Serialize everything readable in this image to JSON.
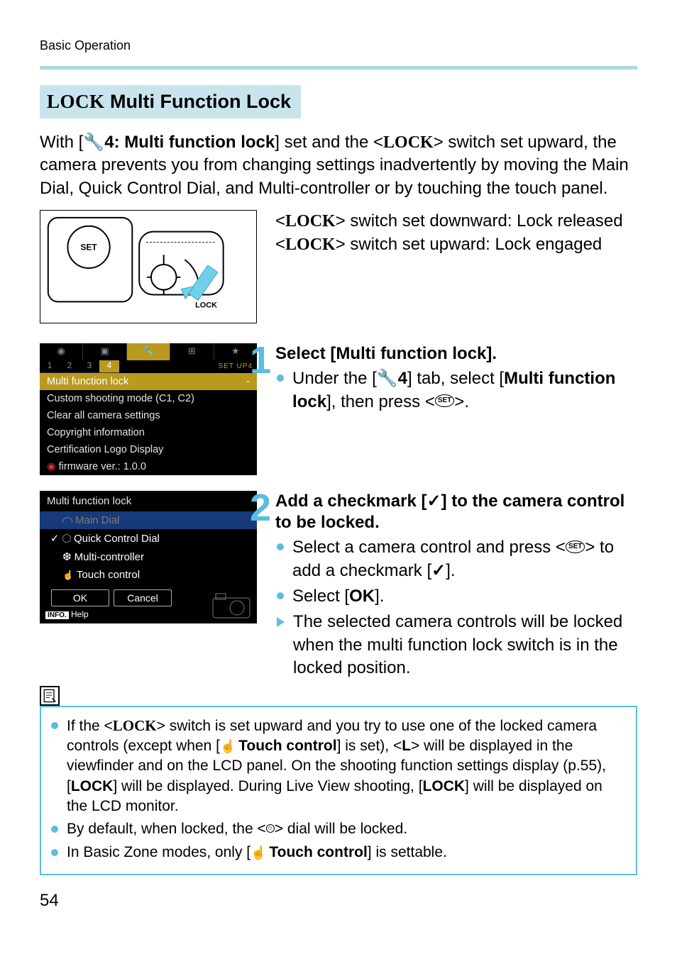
{
  "header": {
    "breadcrumb": "Basic Operation"
  },
  "section_title": {
    "lock": "LOCK",
    "rest": " Multi Function Lock"
  },
  "intro": {
    "pre": "With [",
    "setting": "4: Multi function lock",
    "mid": "] set and the <",
    "lockword": "LOCK",
    "post": "> switch set upward, the camera prevents you from changing settings inadvertently by moving the Main Dial, Quick Control Dial, and Multi-controller or by touching the touch panel."
  },
  "switch_desc": {
    "down_pre": "<",
    "down_lock": "LOCK",
    "down_post": "> switch set downward: Lock released",
    "up_pre": "<",
    "up_lock": "LOCK",
    "up_post": "> switch set upward: Lock engaged"
  },
  "menu1": {
    "setup_label": "SET UP4",
    "nums": [
      "1",
      "2",
      "3",
      "4"
    ],
    "items": [
      {
        "label": "Multi function lock",
        "value": "-",
        "sel": true
      },
      {
        "label": "Custom shooting mode (C1, C2)"
      },
      {
        "label": "Clear all camera settings"
      },
      {
        "label": "Copyright information"
      },
      {
        "label": "Certification Logo Display"
      },
      {
        "label": "firmware ver.: 1.0.0",
        "camicon": true
      }
    ]
  },
  "step1": {
    "num": "1",
    "title": "Select [Multi function lock].",
    "bullet_pre": "Under the [",
    "bullet_tab": "4",
    "bullet_mid": "] tab, select [",
    "bullet_bold": "Multi function lock",
    "bullet_post": "], then press <",
    "bullet_end": ">."
  },
  "menu2": {
    "title": "Multi function lock",
    "rows": [
      {
        "label": "Main Dial",
        "icon": "main",
        "sel": true,
        "chk": false,
        "disabled": true
      },
      {
        "label": "Quick Control Dial",
        "icon": "qcd",
        "chk": true
      },
      {
        "label": "Multi-controller",
        "icon": "multi",
        "chk": false
      },
      {
        "label": "Touch control",
        "icon": "touch",
        "chk": false
      }
    ],
    "ok": "OK",
    "cancel": "Cancel",
    "help_info": "INFO.",
    "help_text": "Help"
  },
  "step2": {
    "num": "2",
    "title": "Add a checkmark [✓] to the camera control to be locked.",
    "b1_a": "Select a camera control and press <",
    "b1_b": "> to add a checkmark [",
    "b1_c": "✓",
    "b1_d": "].",
    "b2_a": "Select [",
    "b2_b": "OK",
    "b2_c": "].",
    "tri": "The selected camera controls will be locked when the multi function lock switch is in the locked position."
  },
  "notes": {
    "n1_a": "If the <",
    "n1_lock": "LOCK",
    "n1_b": "> switch is set upward and you try to use one of the locked camera controls (except when [",
    "n1_touch": "Touch control",
    "n1_c": "] is set), <",
    "n1_L": "L",
    "n1_d": "> will be displayed in the viewfinder and on the LCD panel. On the shooting function settings display (p.55), [",
    "n1_lock2": "LOCK",
    "n1_e": "] will be displayed. During Live View shooting, [",
    "n1_lock3": "LOCK",
    "n1_f": "] will be displayed on the LCD monitor.",
    "n2_a": "By default, when locked, the <",
    "n2_b": "> dial will be locked.",
    "n3_a": "In Basic Zone modes, only [",
    "n3_touch": "Touch control",
    "n3_b": "] is settable."
  },
  "page_number": "54"
}
